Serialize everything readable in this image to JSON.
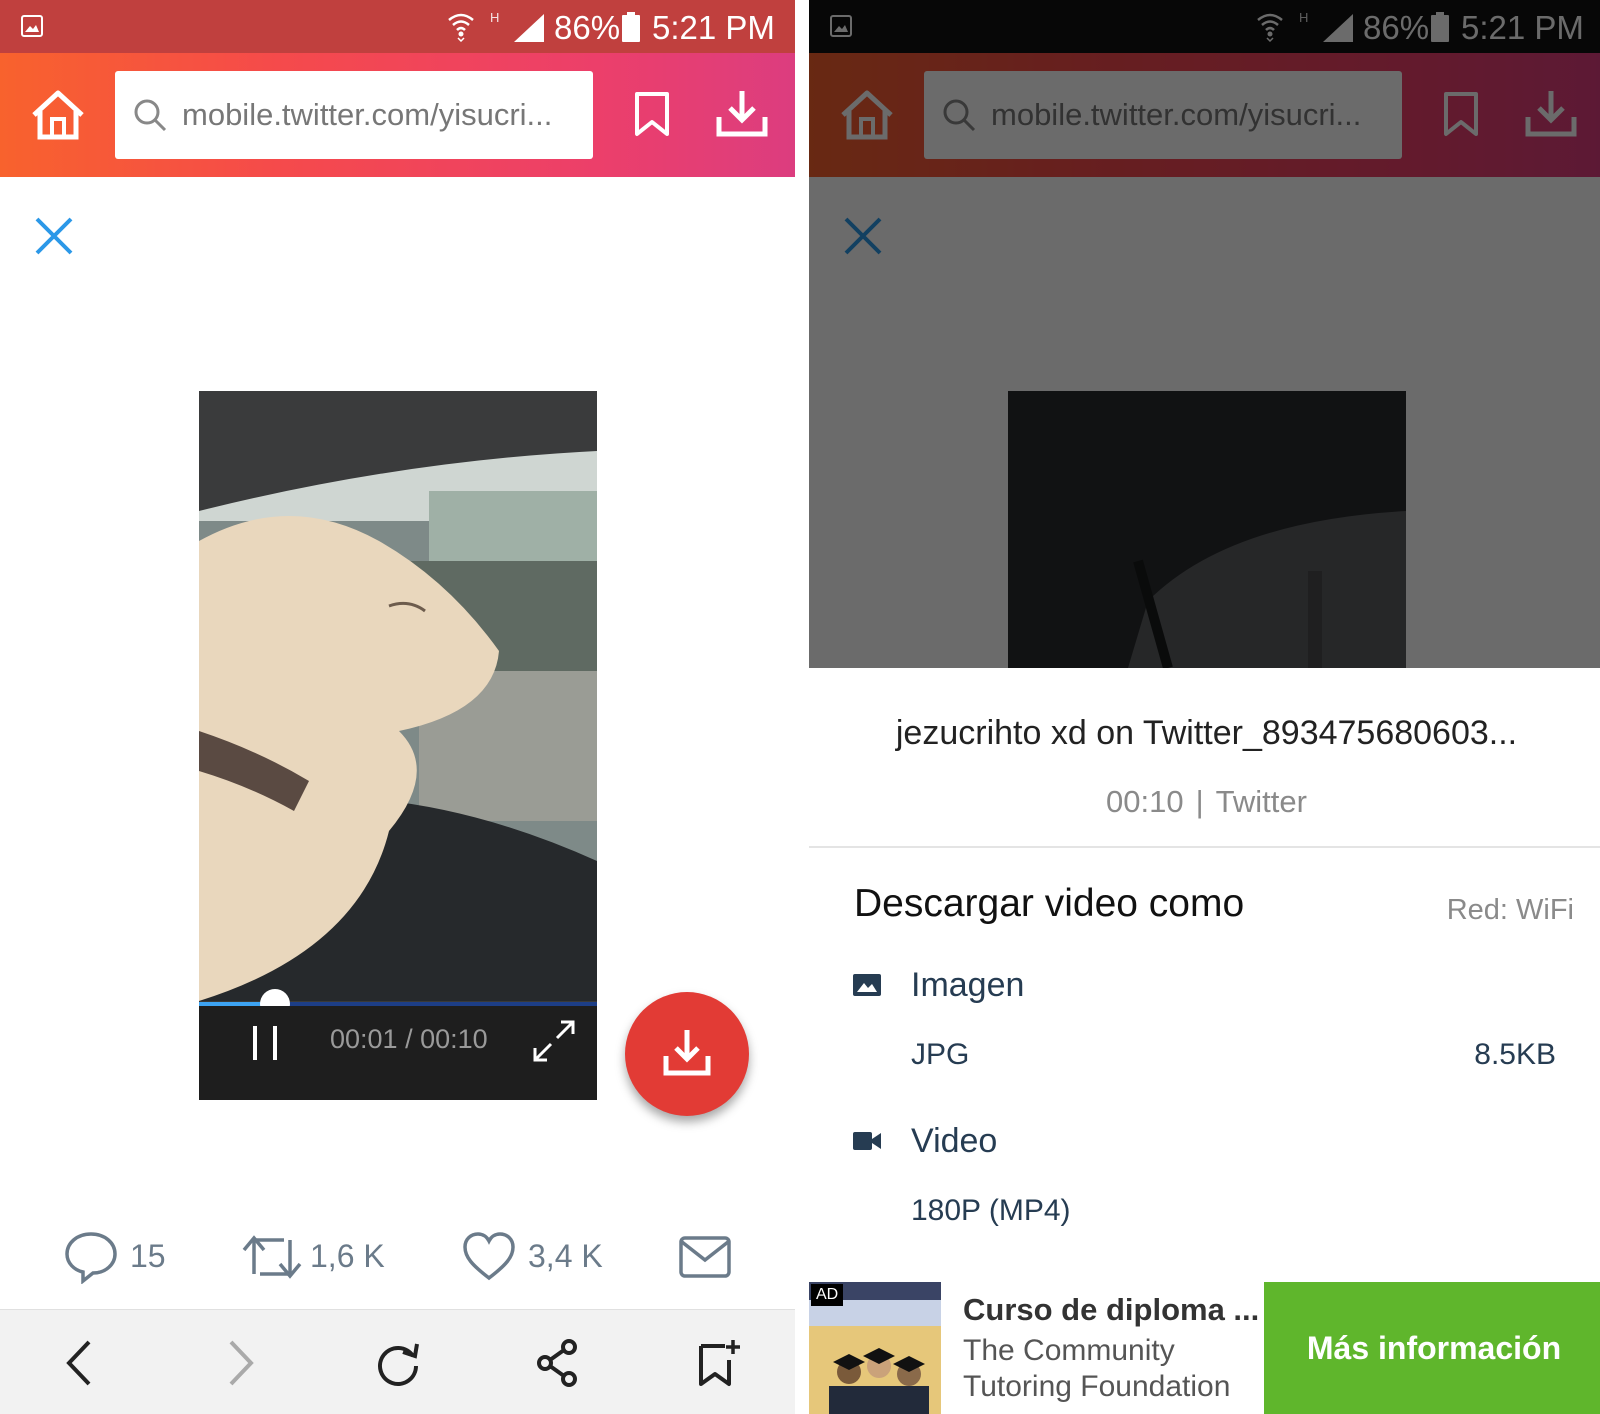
{
  "status_bar": {
    "battery": "86%",
    "time": "5:21 PM",
    "network_type": "H",
    "icons": [
      "gallery-icon",
      "wifi-icon",
      "signal-icon",
      "battery-icon"
    ]
  },
  "toolbar": {
    "url": "mobile.twitter.com/yisucri...",
    "icons": [
      "home-icon",
      "search-icon",
      "bookmark-icon",
      "download-icon"
    ]
  },
  "video": {
    "current_time": "00:01",
    "duration": "00:10",
    "timecode": "00:01 / 00:10",
    "progress": 0.19
  },
  "tweet_actions": {
    "replies": "15",
    "retweets": "1,6 K",
    "likes": "3,4 K"
  },
  "download_sheet": {
    "file_title": "jezucrihto xd on Twitter_893475680603...",
    "duration": "00:10",
    "separator": "|",
    "source": "Twitter",
    "section_title": "Descargar video como",
    "network": "Red:  WiFi",
    "options": [
      {
        "icon": "image-icon",
        "label": "Imagen",
        "format": "JPG",
        "size": "8.5KB"
      },
      {
        "icon": "video-camera-icon",
        "label": "Video",
        "format": "180P  (MP4)",
        "size": ""
      }
    ]
  },
  "ad": {
    "badge": "AD",
    "title": "Curso de diploma ...",
    "line1": "The Community",
    "line2": "Tutoring Foundation",
    "cta": "Más información"
  },
  "colors": {
    "toolbar_gradient_start": "#f8622d",
    "toolbar_gradient_end": "#dc3d7f",
    "status_bar_left": "#c0403e",
    "status_bar_right": "#111111",
    "fab": "#e23b35",
    "close_icon": "#2b98e8",
    "seek_progress": "#3da3f2",
    "cta_green": "#5fb62c"
  }
}
